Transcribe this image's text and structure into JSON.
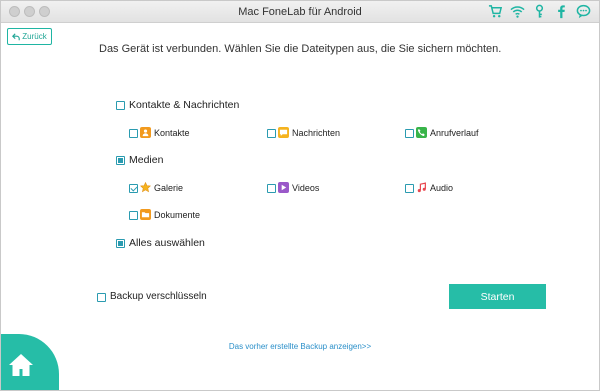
{
  "window": {
    "title": "Mac FoneLab für Android"
  },
  "toolbar_icons": [
    "cart-icon",
    "wifi-icon",
    "key-icon",
    "facebook-icon",
    "chat-icon"
  ],
  "back_label": "Zurück",
  "headline": "Das Gerät ist verbunden. Wählen Sie die Dateitypen aus, die Sie sichern möchten.",
  "categories": {
    "contacts_messages": {
      "label": "Kontakte & Nachrichten",
      "state": "unchecked",
      "items": {
        "contacts": {
          "label": "Kontakte",
          "state": "unchecked",
          "icon": "contacts-icon",
          "color": "#f29a1e"
        },
        "messages": {
          "label": "Nachrichten",
          "state": "unchecked",
          "icon": "message-icon",
          "color": "#f5b31f"
        },
        "calllog": {
          "label": "Anrufverlauf",
          "state": "unchecked",
          "icon": "phone-icon",
          "color": "#38b449"
        }
      }
    },
    "media": {
      "label": "Medien",
      "state": "partial",
      "items": {
        "gallery": {
          "label": "Galerie",
          "state": "checked",
          "icon": "gallery-icon",
          "color": "#f5b31f"
        },
        "videos": {
          "label": "Videos",
          "state": "unchecked",
          "icon": "video-icon",
          "color": "#9a59c9"
        },
        "audio": {
          "label": "Audio",
          "state": "unchecked",
          "icon": "music-icon",
          "color": "#e8474f"
        },
        "documents": {
          "label": "Dokumente",
          "state": "unchecked",
          "icon": "folder-icon",
          "color": "#f29a1e"
        }
      }
    }
  },
  "select_all": {
    "label": "Alles auswählen",
    "state": "partial"
  },
  "encrypt": {
    "label": "Backup verschlüsseln",
    "state": "unchecked"
  },
  "start_label": "Starten",
  "previous_backup_link": "Das vorher erstellte Backup anzeigen>>",
  "colors": {
    "accent": "#26bda7",
    "checkbox": "#2a9bb0",
    "link": "#2a8fc9"
  }
}
